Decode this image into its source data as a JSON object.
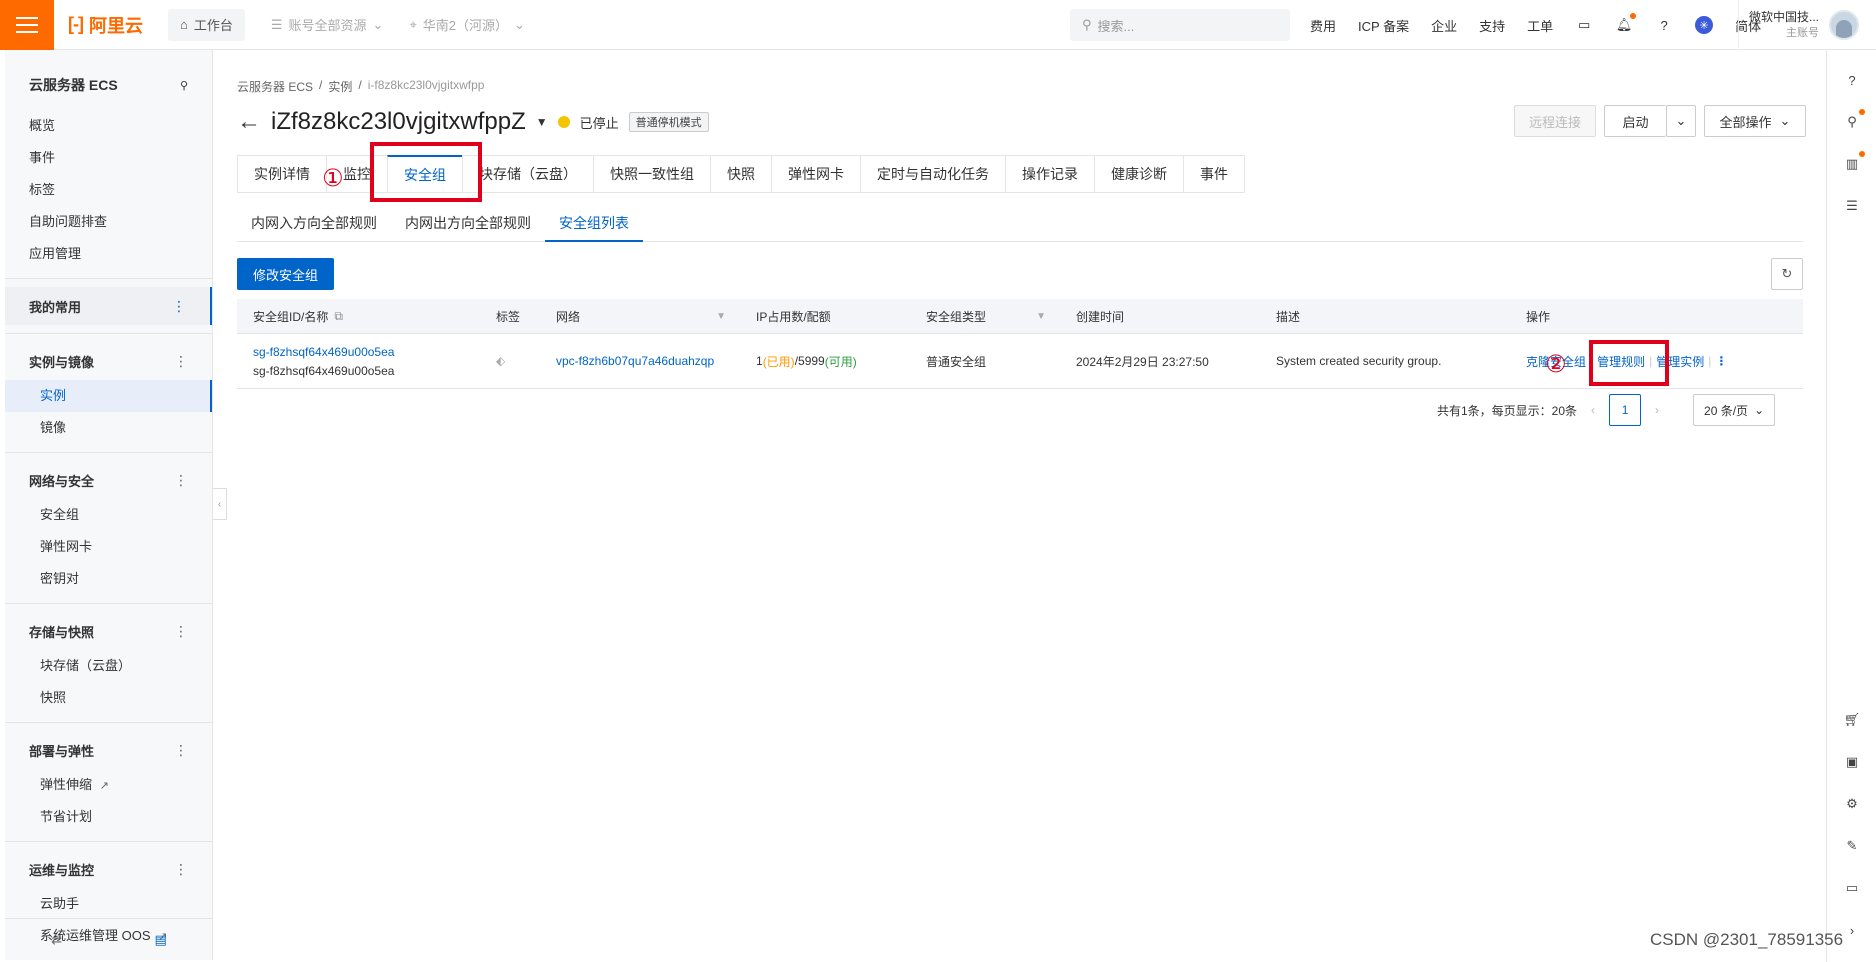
{
  "topbar": {
    "logo_text": "阿里云",
    "workbench": "工作台",
    "resources": "账号全部资源",
    "region": "华南2（河源）",
    "search_placeholder": "搜索...",
    "links": [
      "费用",
      "ICP 备案",
      "企业",
      "支持",
      "工单"
    ],
    "lang": "简体",
    "account_name": "微软中国技...",
    "account_sub": "主账号"
  },
  "sidebar": {
    "title": "云服务器 ECS",
    "top_items": [
      "概览",
      "事件",
      "标签",
      "自助问题排查",
      "应用管理"
    ],
    "favorites": "我的常用",
    "groups": [
      {
        "label": "实例与镜像",
        "items": [
          "实例",
          "镜像"
        ]
      },
      {
        "label": "网络与安全",
        "items": [
          "安全组",
          "弹性网卡",
          "密钥对"
        ]
      },
      {
        "label": "存储与快照",
        "items": [
          "块存储（云盘）",
          "快照"
        ]
      },
      {
        "label": "部署与弹性",
        "items": [
          "弹性伸缩",
          "节省计划"
        ]
      },
      {
        "label": "运维与监控",
        "items": [
          "云助手",
          "系统运维管理 OOS"
        ]
      }
    ]
  },
  "breadcrumb": [
    "云服务器 ECS",
    "实例",
    "i-f8z8kc23l0vjgitxwfpp"
  ],
  "instance": {
    "title": "iZf8z8kc23l0vjgitxwfppZ",
    "status": "已停止",
    "badge": "普通停机模式"
  },
  "actions": {
    "remote": "远程连接",
    "start": "启动",
    "all_ops": "全部操作"
  },
  "tabs": [
    "实例详情",
    "监控",
    "安全组",
    "块存储（云盘）",
    "快照一致性组",
    "快照",
    "弹性网卡",
    "定时与自动化任务",
    "操作记录",
    "健康诊断",
    "事件"
  ],
  "subtabs": [
    "内网入方向全部规则",
    "内网出方向全部规则",
    "安全组列表"
  ],
  "modify_button": "修改安全组",
  "table": {
    "headers": [
      "安全组ID/名称",
      "标签",
      "网络",
      "IP占用数/配额",
      "安全组类型",
      "创建时间",
      "描述",
      "操作"
    ],
    "row": {
      "id": "sg-f8zhsqf64x469u00o5ea",
      "name": "sg-f8zhsqf64x469u00o5ea",
      "vpc": "vpc-f8zh6b07qu7a46duahzqp",
      "ip_used": "1",
      "ip_used_label": "(已用)",
      "ip_quota": "/5999",
      "ip_quota_label": "(可用)",
      "type": "普通安全组",
      "created": "2024年2月29日 23:27:50",
      "desc": "System created security group.",
      "op_clone": "克隆安全组",
      "op_rules": "管理规则",
      "op_instances": "管理实例"
    }
  },
  "pager": {
    "summary": "共有1条，每页显示：20条",
    "page": "1",
    "size": "20 条/页"
  },
  "annotations": [
    "①",
    "②"
  ],
  "watermark": "CSDN @2301_78591356",
  "colors": {
    "brand": "#ff6a00",
    "primary": "#0064c8",
    "annotation": "#e0001b"
  }
}
